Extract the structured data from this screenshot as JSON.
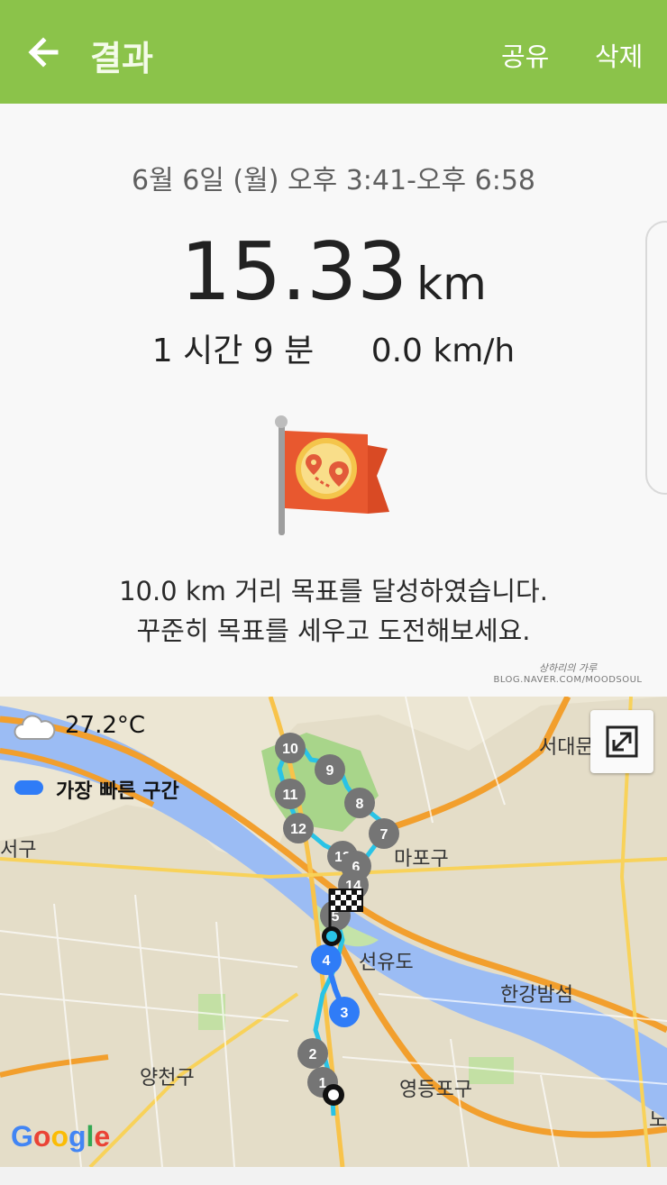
{
  "appbar": {
    "title": "결과",
    "share_label": "공유",
    "delete_label": "삭제",
    "color": "#8bc34a"
  },
  "result": {
    "datetime": "6월 6일 (월) 오후 3:41-오후 6:58",
    "distance_value": "15.33",
    "distance_unit": "km",
    "duration": "1 시간 9 분",
    "speed": "0.0 km/h",
    "goal_message_line1": "10.0 km 거리 목표를 달성하였습니다.",
    "goal_message_line2": "꾸준히 목표를 세우고 도전해보세요."
  },
  "watermark": {
    "name": "상하리의 가루",
    "url": "BLOG.NAVER.COM/MOODSOUL"
  },
  "map": {
    "temperature": "27.2°C",
    "legend_label": "가장 빠른 구간",
    "legend_color": "#2f7cf7",
    "route_color": "#29c3e6",
    "provider": "Google",
    "place_labels": [
      "서대문",
      "서구",
      "마포구",
      "선유도",
      "한강밤섬",
      "양천구",
      "영등포구",
      "노"
    ],
    "markers": [
      "1",
      "2",
      "3",
      "4",
      "5",
      "6",
      "7",
      "8",
      "9",
      "10",
      "11",
      "12",
      "13",
      "14"
    ],
    "fastest_markers": [
      "3",
      "4"
    ]
  }
}
